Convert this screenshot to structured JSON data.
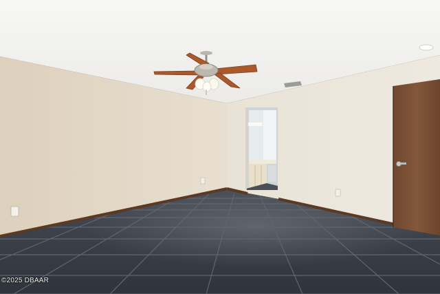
{
  "watermark": {
    "text": "©2025 DBAAR"
  },
  "colors": {
    "ceiling": "#f3f3f1",
    "wall_left": "#e2d6c3",
    "wall_back": "#ebe4d8",
    "baseboard": "#5a3a24",
    "floor_tile": "#3a3f48",
    "grout": "#5e6470",
    "door": "#7a5134",
    "fan_blade": "#a9592b"
  }
}
